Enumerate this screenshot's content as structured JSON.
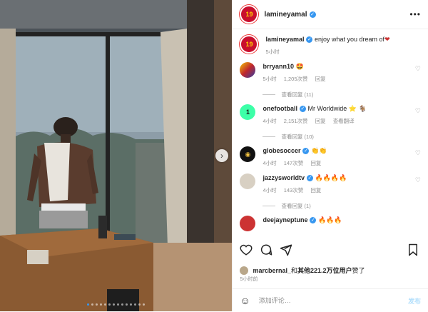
{
  "post_author": {
    "username": "lamineyamal",
    "avatar_text": "19"
  },
  "caption": {
    "username": "lamineyamal",
    "text": "enjoy what you dream of",
    "time": "5小时"
  },
  "comments": [
    {
      "username": "brryann10",
      "text": "🤩",
      "time": "5小时",
      "likes": "1,205次赞",
      "reply": "回复",
      "view_replies": "查看回复 (11)"
    },
    {
      "username": "onefootball",
      "text": "Mr Worldwide ⭐ 🐐",
      "time": "4小时",
      "likes": "2,151次赞",
      "reply": "回复",
      "translate": "查看翻译",
      "view_replies": "查看回复 (10)"
    },
    {
      "username": "globesoccer",
      "text": "👏👏",
      "time": "4小时",
      "likes": "147次赞",
      "reply": "回复"
    },
    {
      "username": "jazzysworldtv",
      "text": "🔥🔥🔥🔥",
      "time": "4小时",
      "likes": "143次赞",
      "reply": "回复",
      "view_replies": "查看回复 (1)"
    },
    {
      "username": "deejayneptune",
      "text": "🔥🔥🔥",
      "time": "",
      "likes": "",
      "reply": ""
    }
  ],
  "likes_line": {
    "user": "marcbernal_",
    "and_others": "和",
    "count_text": "其他221.2万位用户",
    "suffix": "赞了"
  },
  "post_time": "5小时前",
  "add_comment_placeholder": "添加评论…",
  "post_button": "发布",
  "icons": {
    "more": "more-icon",
    "heart": "heart-icon",
    "comment": "comment-icon",
    "share": "share-icon",
    "save": "bookmark-icon",
    "emoji": "emoji-icon",
    "next": "chevron-right-icon"
  },
  "colors": {
    "accent": "#3797f0",
    "post_disabled": "#b2dffc",
    "meta_gray": "#8e8e8e"
  }
}
